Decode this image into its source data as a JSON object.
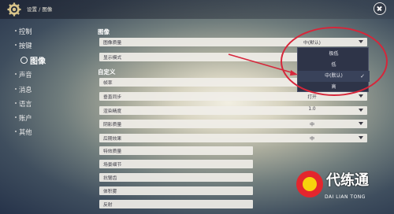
{
  "header": {
    "breadcrumb": "设置 / 图像"
  },
  "sidebar": {
    "items": [
      {
        "label": "控制",
        "active": false
      },
      {
        "label": "按键",
        "active": false
      },
      {
        "label": "图像",
        "active": true
      },
      {
        "label": "声音",
        "active": false
      },
      {
        "label": "消息",
        "active": false
      },
      {
        "label": "语言",
        "active": false
      },
      {
        "label": "账户",
        "active": false
      },
      {
        "label": "其他",
        "active": false
      }
    ]
  },
  "sections": {
    "image": "图像",
    "custom": "自定义"
  },
  "settings": [
    {
      "label": "图像质量",
      "value": "中(默认)"
    },
    {
      "label": "显示模式",
      "value": ""
    },
    {
      "label": "帧率",
      "value": ""
    },
    {
      "label": "垂直同步",
      "value": "打开"
    },
    {
      "label": "渲染精度",
      "value": "1.0"
    },
    {
      "label": "阴影质量",
      "value": "中"
    },
    {
      "label": "后期效果",
      "value": "中"
    },
    {
      "label": "特效质量",
      "value": ""
    },
    {
      "label": "场景细节",
      "value": ""
    },
    {
      "label": "抗锯齿",
      "value": ""
    },
    {
      "label": "体积雾",
      "value": ""
    },
    {
      "label": "反射",
      "value": ""
    }
  ],
  "dropdown": {
    "options": [
      "极低",
      "低",
      "中(默认)",
      "高"
    ],
    "selected": "中(默认)"
  },
  "watermark": {
    "text": "代练通",
    "sub": "DAI LIAN TONG"
  },
  "colors": {
    "annotation": "#d6263a",
    "dropdown_bg": "#2e3448"
  }
}
